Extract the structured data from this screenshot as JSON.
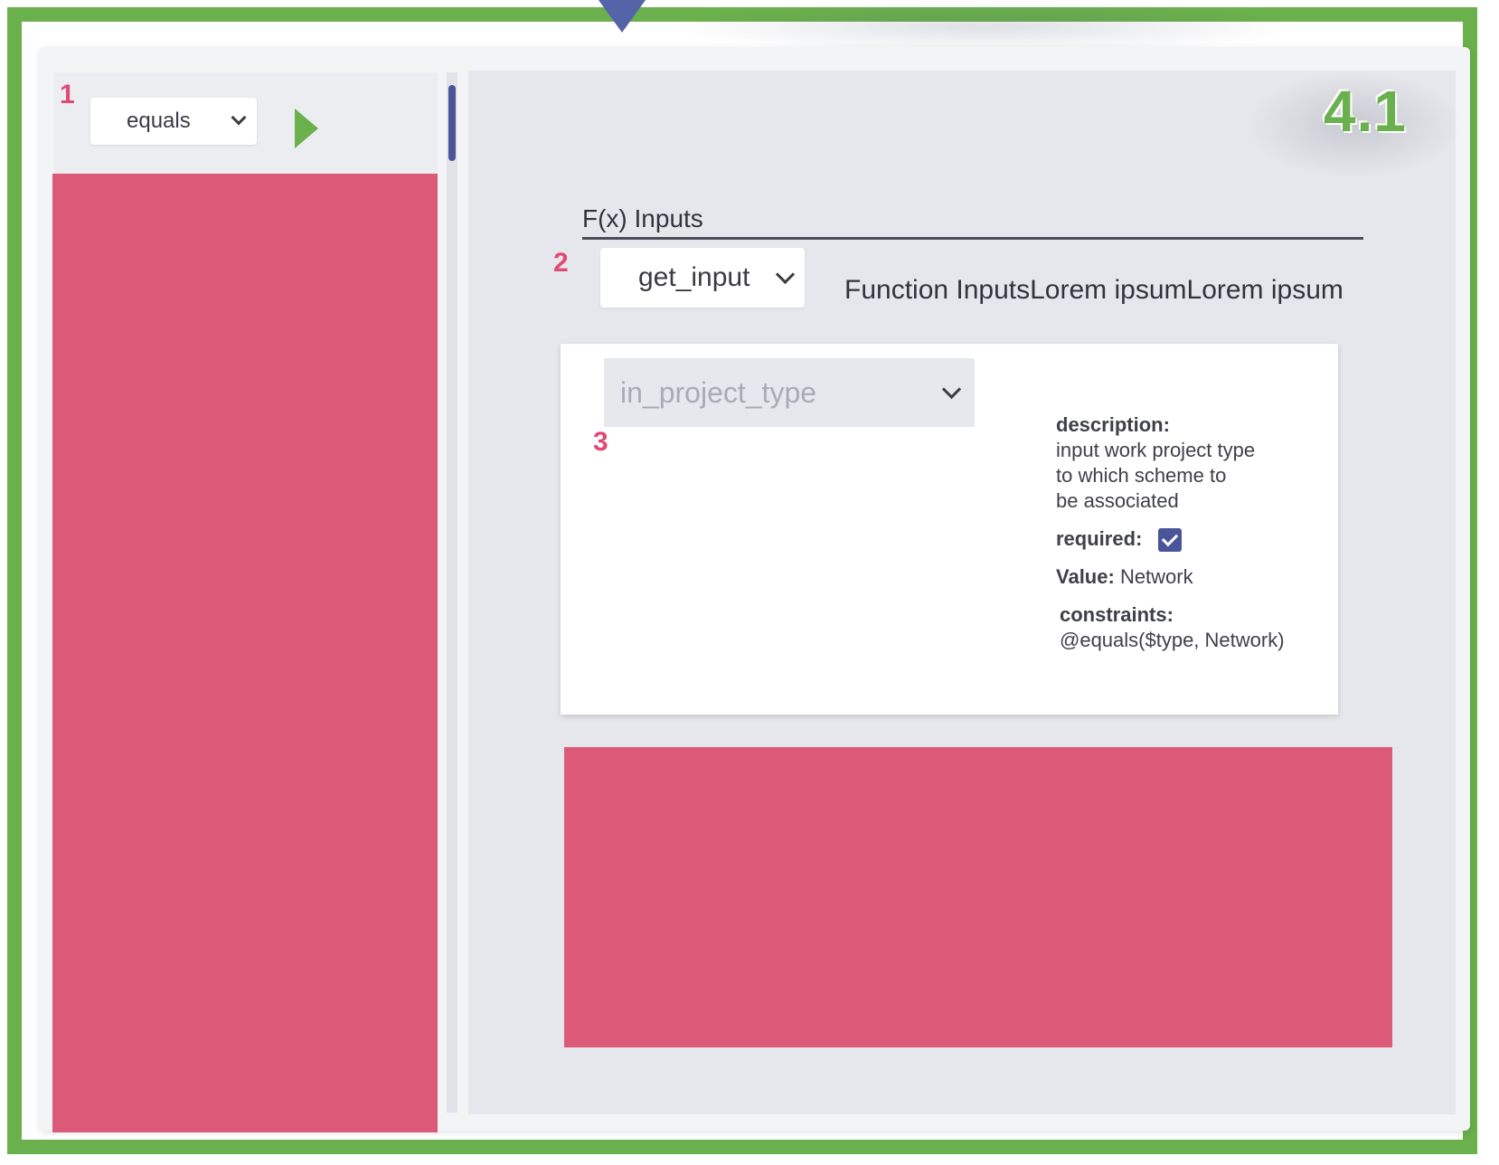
{
  "colors": {
    "frame": "#6ab04c",
    "marker": "#e04a74",
    "accent": "#4a5599",
    "redaction": "#dc5a78"
  },
  "markers": [
    "1",
    "2",
    "3"
  ],
  "left_panel": {
    "operator_select": {
      "value": "equals",
      "icon": "chevron-down-icon"
    },
    "run_icon": "play-icon"
  },
  "right_panel": {
    "version_label": "4.1",
    "section_title": "F(x) Inputs",
    "function_select": {
      "value": "get_input",
      "icon": "chevron-down-icon"
    },
    "function_description": "Function InputsLorem ipsumLorem ipsum",
    "input_card": {
      "input_select": {
        "value": "in_project_type",
        "icon": "chevron-down-icon"
      },
      "description_key": "description:",
      "description_lines": [
        "input work project type",
        "to which scheme to",
        "be associated"
      ],
      "required_key": "required:",
      "required_checked": true,
      "value_key": "Value:",
      "value_text": "Network",
      "constraints_key": "constraints:",
      "constraints_text": "@equals($type, Network)"
    }
  }
}
